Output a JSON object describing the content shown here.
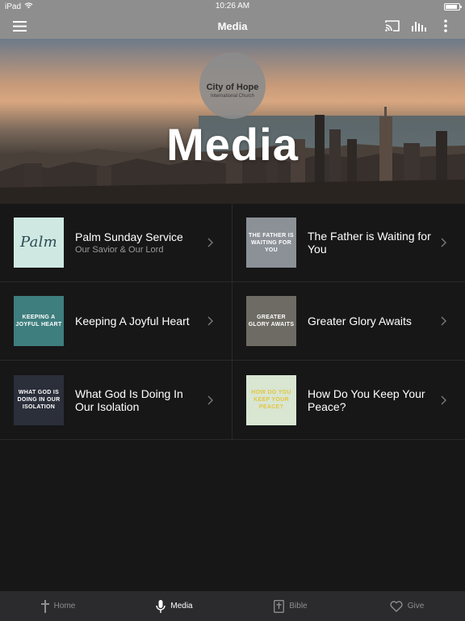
{
  "status": {
    "device": "iPad",
    "time": "10:26 AM",
    "wifi_icon": "wifi-icon",
    "battery_level": 0.85
  },
  "nav": {
    "title": "Media",
    "menu_icon": "hamburger-icon",
    "cast_icon": "cast-icon",
    "audio_icon": "audio-bars-icon",
    "more_icon": "more-vertical-icon"
  },
  "hero": {
    "title": "Media",
    "logo_title": "City of Hope",
    "logo_sub": "International Church"
  },
  "items": [
    {
      "title": "Palm Sunday Service",
      "subtitle": "Our Savior & Our Lord",
      "thumb_text": "Palm",
      "thumb_bg": "#cfe9e2",
      "thumb_fg": "#2c4a55"
    },
    {
      "title": "The Father is Waiting for You",
      "subtitle": "",
      "thumb_text": "THE FATHER IS WAITING FOR YOU",
      "thumb_bg": "#8b9197",
      "thumb_fg": "#ffffff"
    },
    {
      "title": "Keeping A Joyful Heart",
      "subtitle": "",
      "thumb_text": "KEEPING A JOYFUL HEART",
      "thumb_bg": "#3f7e7e",
      "thumb_fg": "#ffffff"
    },
    {
      "title": "Greater Glory Awaits",
      "subtitle": "",
      "thumb_text": "GREATER GLORY AWAITS",
      "thumb_bg": "#6e6b64",
      "thumb_fg": "#ffffff"
    },
    {
      "title": "What God Is Doing In Our Isolation",
      "subtitle": "",
      "thumb_text": "WHAT GOD IS DOING IN OUR ISOLATION",
      "thumb_bg": "#2b2f3a",
      "thumb_fg": "#ffffff"
    },
    {
      "title": "How Do You Keep Your Peace?",
      "subtitle": "",
      "thumb_text": "HOW DO YOU KEEP YOUR PEACE?",
      "thumb_bg": "#d8e6d2",
      "thumb_fg": "#e3c640"
    }
  ],
  "tabs": [
    {
      "label": "Home",
      "icon": "cross-icon",
      "active": false
    },
    {
      "label": "Media",
      "icon": "microphone-icon",
      "active": true
    },
    {
      "label": "Bible",
      "icon": "bible-icon",
      "active": false
    },
    {
      "label": "Give",
      "icon": "heart-icon",
      "active": false
    }
  ]
}
